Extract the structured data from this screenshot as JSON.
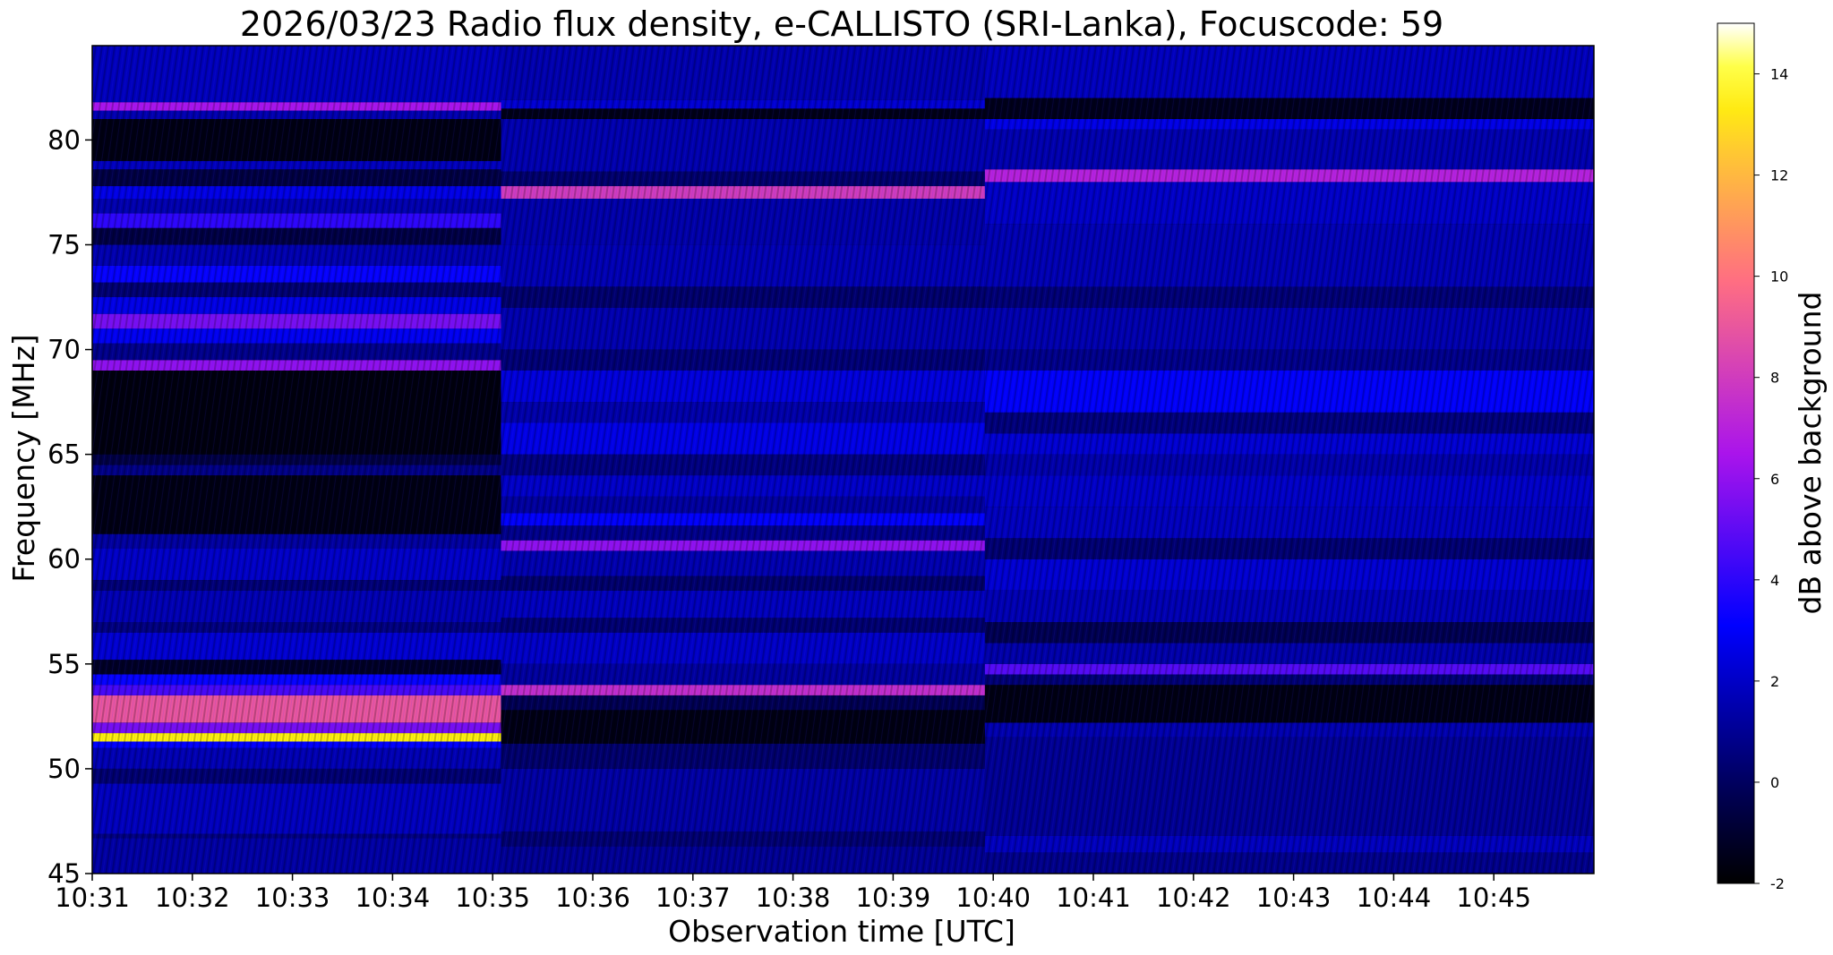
{
  "chart_data": {
    "type": "heatmap",
    "title": "2026/03/23  Radio flux density, e-CALLISTO (SRI-Lanka), Focuscode: 59",
    "xlabel": "Observation time [UTC]",
    "ylabel": "Frequency [MHz]",
    "colorbar_label": "dB above background",
    "colormap": "gnuplot2",
    "x_range": [
      "10:31",
      "10:46"
    ],
    "y_range": [
      45,
      84.5
    ],
    "color_range": [
      -2,
      15
    ],
    "x_ticks": [
      "10:31",
      "10:32",
      "10:33",
      "10:34",
      "10:35",
      "10:36",
      "10:37",
      "10:38",
      "10:39",
      "10:40",
      "10:41",
      "10:42",
      "10:43",
      "10:44",
      "10:45"
    ],
    "y_ticks": [
      "45",
      "50",
      "55",
      "60",
      "65",
      "70",
      "75",
      "80"
    ],
    "colorbar_ticks": [
      "-2",
      "0",
      "2",
      "4",
      "6",
      "8",
      "10",
      "12",
      "14"
    ],
    "segments": [
      {
        "time_range": [
          "10:31",
          "10:35:05"
        ],
        "bands": [
          {
            "mhz": [
              45,
              46.7
            ],
            "db": 1.3
          },
          {
            "mhz": [
              46.7,
              46.9
            ],
            "db": 0.6
          },
          {
            "mhz": [
              46.9,
              49.3
            ],
            "db": 1.8
          },
          {
            "mhz": [
              49.3,
              50.0
            ],
            "db": 0.3
          },
          {
            "mhz": [
              50.0,
              51.0
            ],
            "db": 1.6
          },
          {
            "mhz": [
              51.0,
              51.3
            ],
            "db": 3.0
          },
          {
            "mhz": [
              51.3,
              51.7
            ],
            "db": 13.5
          },
          {
            "mhz": [
              51.7,
              52.2
            ],
            "db": 5.5
          },
          {
            "mhz": [
              52.2,
              53.5
            ],
            "db": 9.0
          },
          {
            "mhz": [
              53.5,
              54.0
            ],
            "db": 4.5
          },
          {
            "mhz": [
              54.0,
              54.5
            ],
            "db": 3.2
          },
          {
            "mhz": [
              54.5,
              55.2
            ],
            "db": -1.2
          },
          {
            "mhz": [
              55.2,
              56.5
            ],
            "db": 2.2
          },
          {
            "mhz": [
              56.5,
              57.0
            ],
            "db": 0.6
          },
          {
            "mhz": [
              57.0,
              58.5
            ],
            "db": 1.6
          },
          {
            "mhz": [
              58.5,
              59.0
            ],
            "db": 0.4
          },
          {
            "mhz": [
              59.0,
              60.5
            ],
            "db": 2.0
          },
          {
            "mhz": [
              60.5,
              61.2
            ],
            "db": 1.2
          },
          {
            "mhz": [
              61.2,
              64.0
            ],
            "db": -1.6
          },
          {
            "mhz": [
              64.0,
              64.5
            ],
            "db": 0.7
          },
          {
            "mhz": [
              64.5,
              65.0
            ],
            "db": -0.6
          },
          {
            "mhz": [
              65.0,
              69.0
            ],
            "db": -1.7
          },
          {
            "mhz": [
              69.0,
              69.5
            ],
            "db": 6.0
          },
          {
            "mhz": [
              69.5,
              70.3
            ],
            "db": 0.8
          },
          {
            "mhz": [
              70.3,
              71.0
            ],
            "db": 2.8
          },
          {
            "mhz": [
              71.0,
              71.7
            ],
            "db": 5.5
          },
          {
            "mhz": [
              71.7,
              72.5
            ],
            "db": 2.6
          },
          {
            "mhz": [
              72.5,
              73.2
            ],
            "db": 0.3
          },
          {
            "mhz": [
              73.2,
              74.0
            ],
            "db": 3.2
          },
          {
            "mhz": [
              74.0,
              75.0
            ],
            "db": 1.5
          },
          {
            "mhz": [
              75.0,
              75.8
            ],
            "db": -0.6
          },
          {
            "mhz": [
              75.8,
              76.5
            ],
            "db": 4.0
          },
          {
            "mhz": [
              76.5,
              77.2
            ],
            "db": 1.5
          },
          {
            "mhz": [
              77.2,
              77.8
            ],
            "db": 2.6
          },
          {
            "mhz": [
              77.8,
              78.6
            ],
            "db": -0.6
          },
          {
            "mhz": [
              78.6,
              79.0
            ],
            "db": 1.8
          },
          {
            "mhz": [
              79.0,
              81.0
            ],
            "db": -1.6
          },
          {
            "mhz": [
              81.0,
              81.4
            ],
            "db": 1.5
          },
          {
            "mhz": [
              81.4,
              81.8
            ],
            "db": 6.5
          },
          {
            "mhz": [
              81.8,
              84.5
            ],
            "db": 1.8
          }
        ]
      },
      {
        "time_range": [
          "10:35:05",
          "10:39:55"
        ],
        "bands": [
          {
            "mhz": [
              45,
              46.3
            ],
            "db": 1.0
          },
          {
            "mhz": [
              46.3,
              47.0
            ],
            "db": 0.3
          },
          {
            "mhz": [
              47.0,
              50.0
            ],
            "db": 1.3
          },
          {
            "mhz": [
              50.0,
              51.2
            ],
            "db": 0.2
          },
          {
            "mhz": [
              51.2,
              52.8
            ],
            "db": -1.6
          },
          {
            "mhz": [
              52.8,
              53.5
            ],
            "db": -0.3
          },
          {
            "mhz": [
              53.5,
              54.0
            ],
            "db": 7.5
          },
          {
            "mhz": [
              54.0,
              55.0
            ],
            "db": 1.2
          },
          {
            "mhz": [
              55.0,
              56.5
            ],
            "db": 2.0
          },
          {
            "mhz": [
              56.5,
              57.2
            ],
            "db": 0.3
          },
          {
            "mhz": [
              57.2,
              58.5
            ],
            "db": 1.8
          },
          {
            "mhz": [
              58.5,
              59.2
            ],
            "db": 0.2
          },
          {
            "mhz": [
              59.2,
              60.4
            ],
            "db": 1.5
          },
          {
            "mhz": [
              60.4,
              60.9
            ],
            "db": 6.0
          },
          {
            "mhz": [
              60.9,
              61.6
            ],
            "db": 0.8
          },
          {
            "mhz": [
              61.6,
              62.2
            ],
            "db": 3.0
          },
          {
            "mhz": [
              62.2,
              63.0
            ],
            "db": 1.2
          },
          {
            "mhz": [
              63.0,
              64.0
            ],
            "db": 2.0
          },
          {
            "mhz": [
              64.0,
              65.0
            ],
            "db": 0.6
          },
          {
            "mhz": [
              65.0,
              66.5
            ],
            "db": 2.6
          },
          {
            "mhz": [
              66.5,
              67.5
            ],
            "db": 1.4
          },
          {
            "mhz": [
              67.5,
              69.0
            ],
            "db": 2.4
          },
          {
            "mhz": [
              69.0,
              70.0
            ],
            "db": 0.4
          },
          {
            "mhz": [
              70.0,
              72.0
            ],
            "db": 1.5
          },
          {
            "mhz": [
              72.0,
              73.0
            ],
            "db": 0.2
          },
          {
            "mhz": [
              73.0,
              75.0
            ],
            "db": 1.6
          },
          {
            "mhz": [
              75.0,
              77.2
            ],
            "db": 1.4
          },
          {
            "mhz": [
              77.2,
              77.8
            ],
            "db": 8.0
          },
          {
            "mhz": [
              77.8,
              78.5
            ],
            "db": 0.2
          },
          {
            "mhz": [
              78.5,
              81.0
            ],
            "db": 1.5
          },
          {
            "mhz": [
              81.0,
              81.5
            ],
            "db": -1.5
          },
          {
            "mhz": [
              81.5,
              81.9
            ],
            "db": 2.2
          },
          {
            "mhz": [
              81.9,
              84.5
            ],
            "db": 1.5
          }
        ]
      },
      {
        "time_range": [
          "10:39:55",
          "10:46"
        ],
        "bands": [
          {
            "mhz": [
              45,
              46.0
            ],
            "db": 0.8
          },
          {
            "mhz": [
              46.0,
              46.8
            ],
            "db": 1.8
          },
          {
            "mhz": [
              46.8,
              51.5
            ],
            "db": 1.0
          },
          {
            "mhz": [
              51.5,
              52.2
            ],
            "db": 1.5
          },
          {
            "mhz": [
              52.2,
              54.0
            ],
            "db": -1.6
          },
          {
            "mhz": [
              54.0,
              54.5
            ],
            "db": 0.4
          },
          {
            "mhz": [
              54.5,
              55.0
            ],
            "db": 4.8
          },
          {
            "mhz": [
              55.0,
              56.0
            ],
            "db": 1.4
          },
          {
            "mhz": [
              56.0,
              57.0
            ],
            "db": -0.3
          },
          {
            "mhz": [
              57.0,
              58.5
            ],
            "db": 1.6
          },
          {
            "mhz": [
              58.5,
              60.0
            ],
            "db": 2.2
          },
          {
            "mhz": [
              60.0,
              61.0
            ],
            "db": 0.3
          },
          {
            "mhz": [
              61.0,
              62.5
            ],
            "db": 1.8
          },
          {
            "mhz": [
              62.5,
              64.0
            ],
            "db": 2.0
          },
          {
            "mhz": [
              64.0,
              65.0
            ],
            "db": 1.4
          },
          {
            "mhz": [
              65.0,
              66.0
            ],
            "db": 2.2
          },
          {
            "mhz": [
              66.0,
              67.0
            ],
            "db": 0.5
          },
          {
            "mhz": [
              67.0,
              69.0
            ],
            "db": 3.0
          },
          {
            "mhz": [
              69.0,
              70.0
            ],
            "db": 0.8
          },
          {
            "mhz": [
              70.0,
              72.0
            ],
            "db": 1.5
          },
          {
            "mhz": [
              72.0,
              73.0
            ],
            "db": 0.4
          },
          {
            "mhz": [
              73.0,
              76.0
            ],
            "db": 1.6
          },
          {
            "mhz": [
              76.0,
              78.0
            ],
            "db": 2.0
          },
          {
            "mhz": [
              78.0,
              78.6
            ],
            "db": 7.0
          },
          {
            "mhz": [
              78.6,
              80.5
            ],
            "db": 1.5
          },
          {
            "mhz": [
              80.5,
              81.0
            ],
            "db": 2.6
          },
          {
            "mhz": [
              81.0,
              82.0
            ],
            "db": -1.4
          },
          {
            "mhz": [
              82.0,
              84.5
            ],
            "db": 1.8
          }
        ]
      }
    ]
  }
}
